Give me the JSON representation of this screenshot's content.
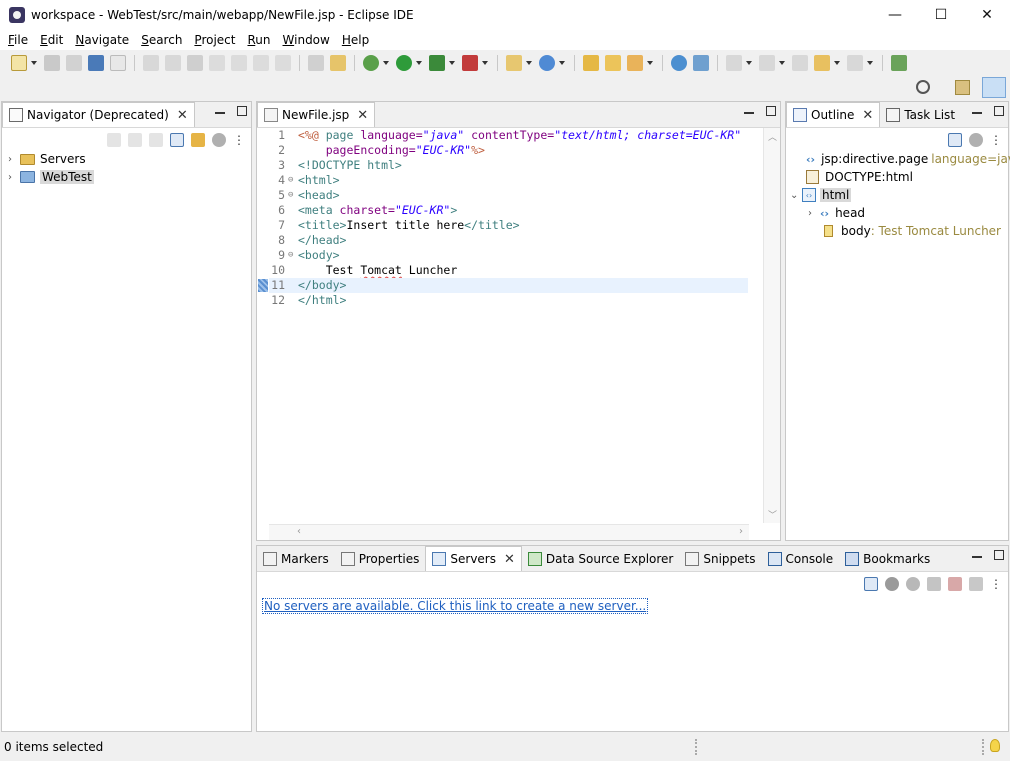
{
  "window": {
    "title": "workspace - WebTest/src/main/webapp/NewFile.jsp - Eclipse IDE",
    "minimize": "—",
    "maximize": "☐",
    "close": "✕"
  },
  "menu": [
    {
      "mnemonic": "F",
      "rest": "ile"
    },
    {
      "mnemonic": "E",
      "rest": "dit"
    },
    {
      "mnemonic": "N",
      "rest": "avigate"
    },
    {
      "mnemonic": "S",
      "rest": "earch"
    },
    {
      "mnemonic": "P",
      "rest": "roject"
    },
    {
      "mnemonic": "R",
      "rest": "un"
    },
    {
      "mnemonic": "W",
      "rest": "indow"
    },
    {
      "mnemonic": "H",
      "rest": "elp"
    }
  ],
  "navigator": {
    "tab_label": "Navigator (Deprecated)",
    "items": [
      {
        "label": "Servers"
      },
      {
        "label": "WebTest"
      }
    ]
  },
  "editor": {
    "tab_label": "NewFile.jsp",
    "lines": [
      "1",
      "2",
      "3",
      "4",
      "5",
      "6",
      "7",
      "8",
      "9",
      "10",
      "11",
      "12"
    ],
    "text": {
      "l1_open": "<%@ ",
      "l1_page": "page ",
      "l1_lang_attr": "language=",
      "l1_lang_val": "\"java\"",
      "l1_ct_attr": " contentType=",
      "l1_ct_val": "\"text/html; charset=EUC-KR\"",
      "l2_indent": "    ",
      "l2_pe_attr": "pageEncoding=",
      "l2_pe_val": "\"EUC-KR\"",
      "l2_close": "%>",
      "l3": "<!DOCTYPE html>",
      "l4": "<html>",
      "l5": "<head>",
      "l6_tag": "<meta ",
      "l6_attr": "charset=",
      "l6_val": "\"EUC-KR\"",
      "l6_close": ">",
      "l7_open": "<title>",
      "l7_text": "Insert title here",
      "l7_close": "</title>",
      "l8": "</head>",
      "l9": "<body>",
      "l10_indent": "    Test ",
      "l10_word": "Tomcat",
      "l10_rest": " Luncher",
      "l11": "</body>",
      "l12": "</html>"
    }
  },
  "outline": {
    "tab_label": "Outline",
    "task_tab_label": "Task List",
    "items": {
      "directive": "jsp:directive.page",
      "directive_hint": "language=java",
      "doctype": "DOCTYPE:html",
      "html": "html",
      "head": "head",
      "body": "body",
      "body_hint": " : Test Tomcat Luncher"
    }
  },
  "bottom": {
    "tabs": {
      "markers": "Markers",
      "properties": "Properties",
      "servers": "Servers",
      "datasource": "Data Source Explorer",
      "snippets": "Snippets",
      "console": "Console",
      "bookmarks": "Bookmarks"
    },
    "server_link": "No servers are available. Click this link to create a new server..."
  },
  "status": {
    "text": "0 items selected"
  }
}
